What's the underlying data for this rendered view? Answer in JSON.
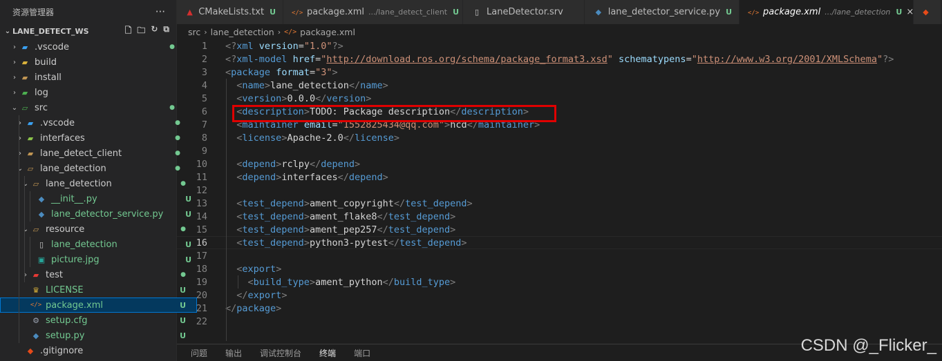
{
  "sidebar": {
    "title": "资源管理器",
    "more": "···",
    "workspace": "LANE_DETECT_WS",
    "items": [
      {
        "label": ".vscode",
        "icon": "vscode-folder-icon",
        "status": "●",
        "statusType": "dot"
      },
      {
        "label": "build",
        "icon": "build-folder-icon",
        "status": "",
        "statusType": ""
      },
      {
        "label": "install",
        "icon": "folder-icon",
        "status": "",
        "statusType": ""
      },
      {
        "label": "log",
        "icon": "log-folder-icon",
        "status": "",
        "statusType": ""
      },
      {
        "label": "src",
        "icon": "src-folder-icon",
        "status": "●",
        "statusType": "dot"
      },
      {
        "label": ".vscode",
        "icon": "vscode-folder-icon",
        "status": "●",
        "statusType": "dot"
      },
      {
        "label": "interfaces",
        "icon": "interfaces-folder-icon",
        "status": "●",
        "statusType": "dot"
      },
      {
        "label": "lane_detect_client",
        "icon": "folder-icon",
        "status": "●",
        "statusType": "dot"
      },
      {
        "label": "lane_detection",
        "icon": "folder-open-icon",
        "status": "●",
        "statusType": "dot"
      },
      {
        "label": "lane_detection",
        "icon": "folder-open-icon",
        "status": "●",
        "statusType": "dot"
      },
      {
        "label": "__init__.py",
        "icon": "python-file-icon",
        "status": "U",
        "statusType": "u"
      },
      {
        "label": "lane_detector_service.py",
        "icon": "python-file-icon",
        "status": "U",
        "statusType": "u"
      },
      {
        "label": "resource",
        "icon": "folder-open-icon",
        "status": "●",
        "statusType": "dot"
      },
      {
        "label": "lane_detection",
        "icon": "file-icon",
        "status": "U",
        "statusType": "u"
      },
      {
        "label": "picture.jpg",
        "icon": "image-file-icon",
        "status": "U",
        "statusType": "u"
      },
      {
        "label": "test",
        "icon": "test-folder-icon",
        "status": "●",
        "statusType": "dot"
      },
      {
        "label": "LICENSE",
        "icon": "license-file-icon",
        "status": "U",
        "statusType": "u"
      },
      {
        "label": "package.xml",
        "icon": "xml-file-icon",
        "status": "U",
        "statusType": "u"
      },
      {
        "label": "setup.cfg",
        "icon": "gear-file-icon",
        "status": "U",
        "statusType": "u"
      },
      {
        "label": "setup.py",
        "icon": "python-file-icon",
        "status": "U",
        "statusType": "u"
      },
      {
        "label": ".gitignore",
        "icon": "git-file-icon",
        "status": "",
        "statusType": ""
      }
    ]
  },
  "tabs": [
    {
      "label": "CMakeLists.txt",
      "path": "",
      "status": "U",
      "icon": "cmake-icon"
    },
    {
      "label": "package.xml",
      "path": ".../lane_detect_client",
      "status": "U",
      "icon": "xml-file-icon"
    },
    {
      "label": "LaneDetector.srv",
      "path": "",
      "status": "",
      "icon": "file-icon"
    },
    {
      "label": "lane_detector_service.py",
      "path": "",
      "status": "U",
      "icon": "python-file-icon"
    },
    {
      "label": "package.xml",
      "path": ".../lane_detection",
      "status": "U",
      "icon": "xml-file-icon"
    }
  ],
  "breadcrumb": [
    "src",
    "lane_detection",
    "package.xml"
  ],
  "editor": {
    "current_line": 16,
    "lines": [
      [
        [
          "pn",
          "<?"
        ],
        [
          "tg",
          "xml"
        ],
        [
          "tx",
          " "
        ],
        [
          "at",
          "version"
        ],
        [
          "tx",
          "="
        ],
        [
          "sv",
          "\"1.0\""
        ],
        [
          "pn",
          "?>"
        ]
      ],
      [
        [
          "pn",
          "<?"
        ],
        [
          "tg",
          "xml-model"
        ],
        [
          "tx",
          " "
        ],
        [
          "at",
          "href"
        ],
        [
          "tx",
          "="
        ],
        [
          "sv",
          "\""
        ],
        [
          "svl",
          "http://download.ros.org/schema/package_format3.xsd"
        ],
        [
          "sv",
          "\""
        ],
        [
          "tx",
          " "
        ],
        [
          "at",
          "schematypens"
        ],
        [
          "tx",
          "="
        ],
        [
          "sv",
          "\""
        ],
        [
          "svl",
          "http://www.w3.org/2001/XMLSchema"
        ],
        [
          "sv",
          "\""
        ],
        [
          "pn",
          "?>"
        ]
      ],
      [
        [
          "pn",
          "<"
        ],
        [
          "tg",
          "package"
        ],
        [
          "tx",
          " "
        ],
        [
          "at",
          "format"
        ],
        [
          "tx",
          "="
        ],
        [
          "sv",
          "\"3\""
        ],
        [
          "pn",
          ">"
        ]
      ],
      [
        [
          "tx",
          "  "
        ],
        [
          "pn",
          "<"
        ],
        [
          "tg",
          "name"
        ],
        [
          "pn",
          ">"
        ],
        [
          "tx",
          "lane_detection"
        ],
        [
          "pn",
          "</"
        ],
        [
          "tg",
          "name"
        ],
        [
          "pn",
          ">"
        ]
      ],
      [
        [
          "tx",
          "  "
        ],
        [
          "pn",
          "<"
        ],
        [
          "tg",
          "version"
        ],
        [
          "pn",
          ">"
        ],
        [
          "tx",
          "0.0.0"
        ],
        [
          "pn",
          "</"
        ],
        [
          "tg",
          "version"
        ],
        [
          "pn",
          ">"
        ]
      ],
      [
        [
          "tx",
          "  "
        ],
        [
          "pn",
          "<"
        ],
        [
          "tg",
          "description"
        ],
        [
          "pn",
          ">"
        ],
        [
          "tx",
          "TODO: Package description"
        ],
        [
          "pn",
          "</"
        ],
        [
          "tg",
          "description"
        ],
        [
          "pn",
          ">"
        ]
      ],
      [
        [
          "tx",
          "  "
        ],
        [
          "pn",
          "<"
        ],
        [
          "tg",
          "maintainer"
        ],
        [
          "tx",
          " "
        ],
        [
          "at",
          "email"
        ],
        [
          "tx",
          "="
        ],
        [
          "sv",
          "\"1552825434@qq.com\""
        ],
        [
          "pn",
          ">"
        ],
        [
          "tx",
          "hcd"
        ],
        [
          "pn",
          "</"
        ],
        [
          "tg",
          "maintainer"
        ],
        [
          "pn",
          ">"
        ]
      ],
      [
        [
          "tx",
          "  "
        ],
        [
          "pn",
          "<"
        ],
        [
          "tg",
          "license"
        ],
        [
          "pn",
          ">"
        ],
        [
          "tx",
          "Apache-2.0"
        ],
        [
          "pn",
          "</"
        ],
        [
          "tg",
          "license"
        ],
        [
          "pn",
          ">"
        ]
      ],
      [],
      [
        [
          "tx",
          "  "
        ],
        [
          "pn",
          "<"
        ],
        [
          "tg",
          "depend"
        ],
        [
          "pn",
          ">"
        ],
        [
          "tx",
          "rclpy"
        ],
        [
          "pn",
          "</"
        ],
        [
          "tg",
          "depend"
        ],
        [
          "pn",
          ">"
        ]
      ],
      [
        [
          "tx",
          "  "
        ],
        [
          "pn",
          "<"
        ],
        [
          "tg",
          "depend"
        ],
        [
          "pn",
          ">"
        ],
        [
          "tx",
          "interfaces"
        ],
        [
          "pn",
          "</"
        ],
        [
          "tg",
          "depend"
        ],
        [
          "pn",
          ">"
        ]
      ],
      [],
      [
        [
          "tx",
          "  "
        ],
        [
          "pn",
          "<"
        ],
        [
          "tg",
          "test_depend"
        ],
        [
          "pn",
          ">"
        ],
        [
          "tx",
          "ament_copyright"
        ],
        [
          "pn",
          "</"
        ],
        [
          "tg",
          "test_depend"
        ],
        [
          "pn",
          ">"
        ]
      ],
      [
        [
          "tx",
          "  "
        ],
        [
          "pn",
          "<"
        ],
        [
          "tg",
          "test_depend"
        ],
        [
          "pn",
          ">"
        ],
        [
          "tx",
          "ament_flake8"
        ],
        [
          "pn",
          "</"
        ],
        [
          "tg",
          "test_depend"
        ],
        [
          "pn",
          ">"
        ]
      ],
      [
        [
          "tx",
          "  "
        ],
        [
          "pn",
          "<"
        ],
        [
          "tg",
          "test_depend"
        ],
        [
          "pn",
          ">"
        ],
        [
          "tx",
          "ament_pep257"
        ],
        [
          "pn",
          "</"
        ],
        [
          "tg",
          "test_depend"
        ],
        [
          "pn",
          ">"
        ]
      ],
      [
        [
          "tx",
          "  "
        ],
        [
          "pn",
          "<"
        ],
        [
          "tg",
          "test_depend"
        ],
        [
          "pn",
          ">"
        ],
        [
          "tx",
          "python3-pytest"
        ],
        [
          "pn",
          "</"
        ],
        [
          "tg",
          "test_depend"
        ],
        [
          "pn",
          ">"
        ]
      ],
      [],
      [
        [
          "tx",
          "  "
        ],
        [
          "pn",
          "<"
        ],
        [
          "tg",
          "export"
        ],
        [
          "pn",
          ">"
        ]
      ],
      [
        [
          "tx",
          "    "
        ],
        [
          "pn",
          "<"
        ],
        [
          "tg",
          "build_type"
        ],
        [
          "pn",
          ">"
        ],
        [
          "tx",
          "ament_python"
        ],
        [
          "pn",
          "</"
        ],
        [
          "tg",
          "build_type"
        ],
        [
          "pn",
          ">"
        ]
      ],
      [
        [
          "tx",
          "  "
        ],
        [
          "pn",
          "</"
        ],
        [
          "tg",
          "export"
        ],
        [
          "pn",
          ">"
        ]
      ],
      [
        [
          "pn",
          "</"
        ],
        [
          "tg",
          "package"
        ],
        [
          "pn",
          ">"
        ]
      ],
      []
    ]
  },
  "panel_tabs": [
    "问题",
    "输出",
    "调试控制台",
    "终端",
    "端口"
  ],
  "panel_active": "终端",
  "watermark": "CSDN @_Flicker_"
}
